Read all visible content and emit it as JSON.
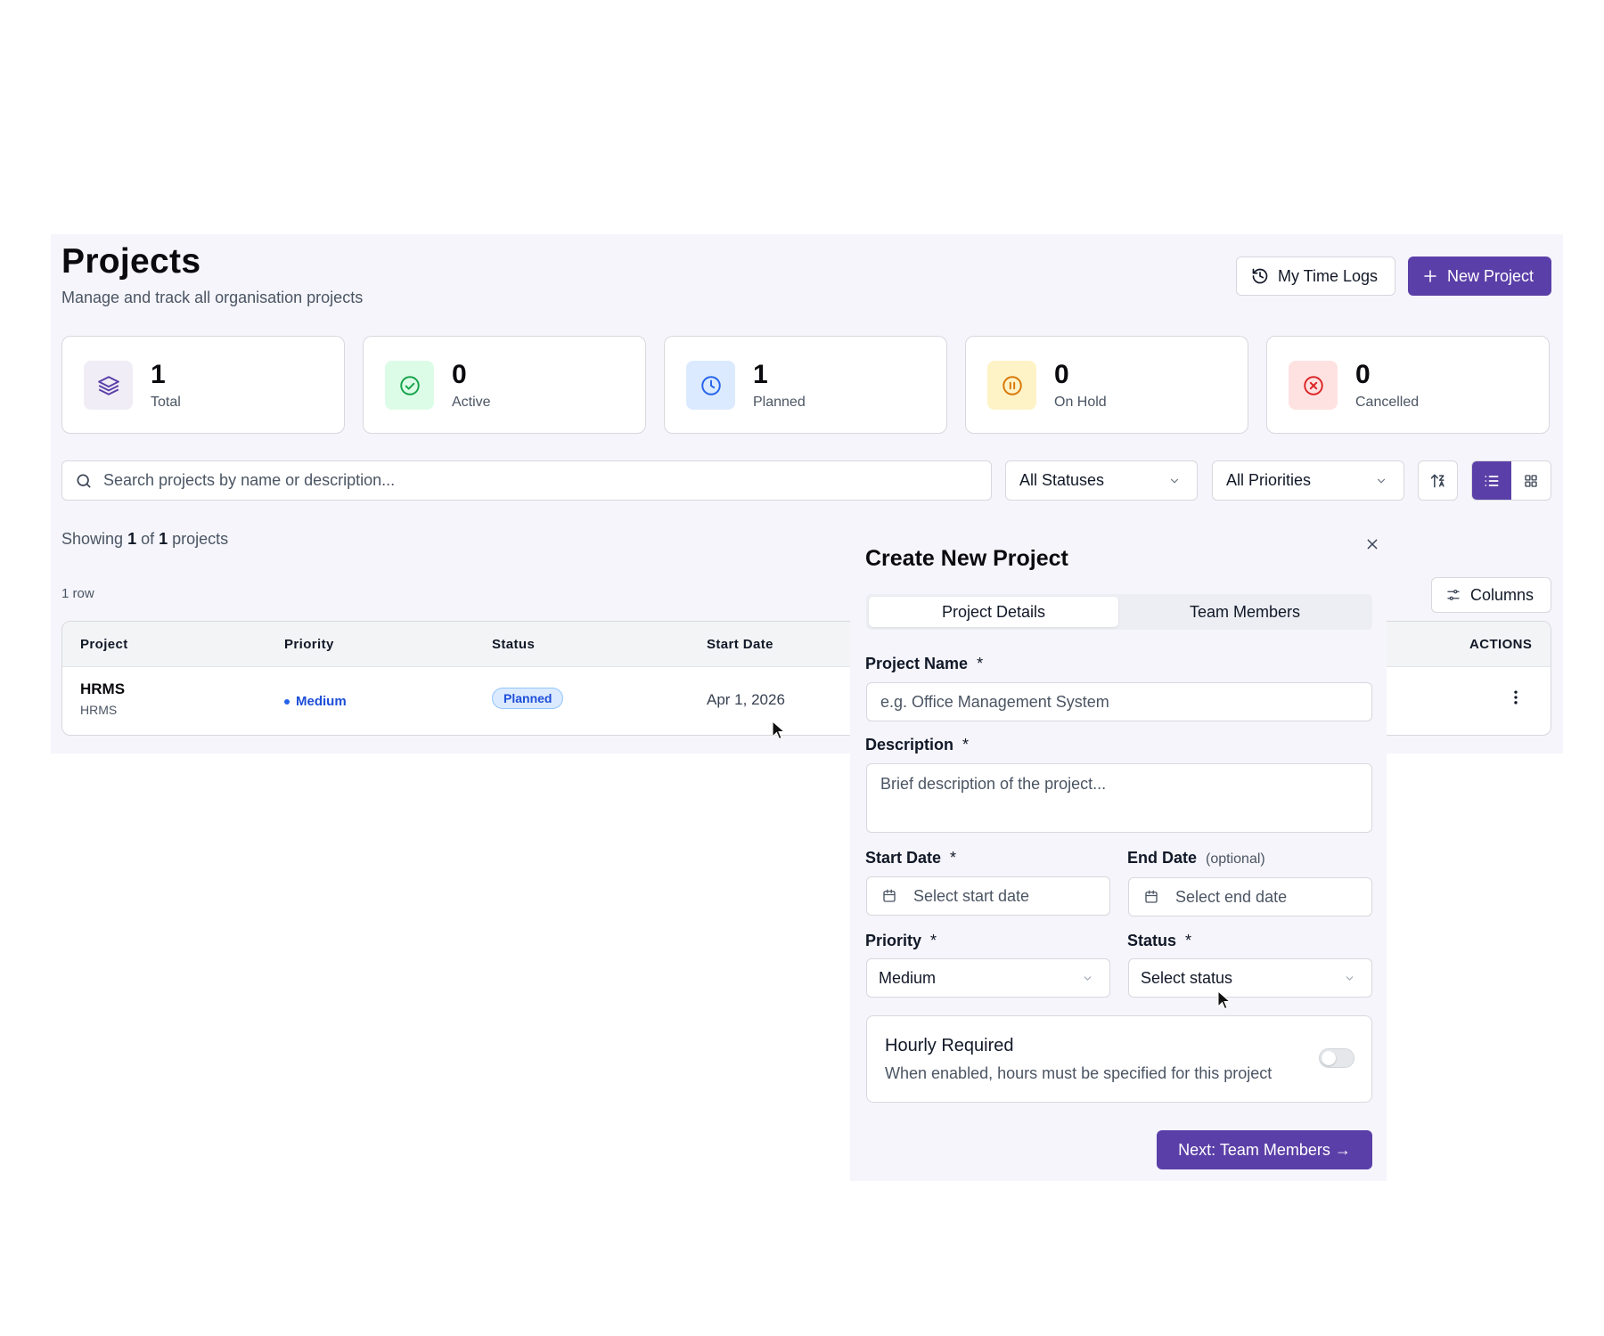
{
  "header": {
    "title": "Projects",
    "subtitle": "Manage and track all organisation projects",
    "time_logs_label": "My Time Logs",
    "new_project_label": "New Project"
  },
  "stats": [
    {
      "value": "1",
      "label": "Total",
      "icon": "layers-icon",
      "color": "#5b3fa8",
      "bg": "#f0edf6"
    },
    {
      "value": "0",
      "label": "Active",
      "icon": "check-circle-icon",
      "color": "#16a34a",
      "bg": "#dcfce7"
    },
    {
      "value": "1",
      "label": "Planned",
      "icon": "clock-icon",
      "color": "#2563eb",
      "bg": "#dbeafe"
    },
    {
      "value": "0",
      "label": "On Hold",
      "icon": "pause-circle-icon",
      "color": "#d97706",
      "bg": "#fef3c7"
    },
    {
      "value": "0",
      "label": "Cancelled",
      "icon": "x-circle-icon",
      "color": "#dc2626",
      "bg": "#fee2e2"
    }
  ],
  "filters": {
    "search_placeholder": "Search projects by name or description...",
    "status_value": "All Statuses",
    "priority_value": "All Priorities"
  },
  "results": {
    "prefix": "Showing",
    "shown": "1",
    "of": "of",
    "total": "1",
    "suffix": "projects",
    "row_count": "1 row",
    "columns_label": "Columns"
  },
  "table": {
    "headers": {
      "project": "Project",
      "priority": "Priority",
      "status": "Status",
      "start_date": "Start Date",
      "actions": "ACTIONS"
    },
    "rows": [
      {
        "name": "HRMS",
        "code": "HRMS",
        "priority": "Medium",
        "status": "Planned",
        "start_date": "Apr 1, 2026"
      }
    ]
  },
  "modal": {
    "title": "Create New Project",
    "tabs": [
      "Project Details",
      "Team Members"
    ],
    "project_name_label": "Project Name",
    "project_name_placeholder": "e.g. Office Management System",
    "description_label": "Description",
    "description_placeholder": "Brief description of the project...",
    "start_date_label": "Start Date",
    "start_date_placeholder": "Select start date",
    "end_date_label": "End Date",
    "end_date_optional": "(optional)",
    "end_date_placeholder": "Select end date",
    "priority_label": "Priority",
    "priority_value": "Medium",
    "status_label": "Status",
    "status_value": "Select status",
    "required_mark": "*",
    "hourly_title": "Hourly Required",
    "hourly_desc": "When enabled, hours must be specified for this project",
    "next_label": "Next: Team Members →"
  },
  "colors": {
    "accent": "#5b3fa8",
    "page_bg": "#f5f5fb"
  }
}
